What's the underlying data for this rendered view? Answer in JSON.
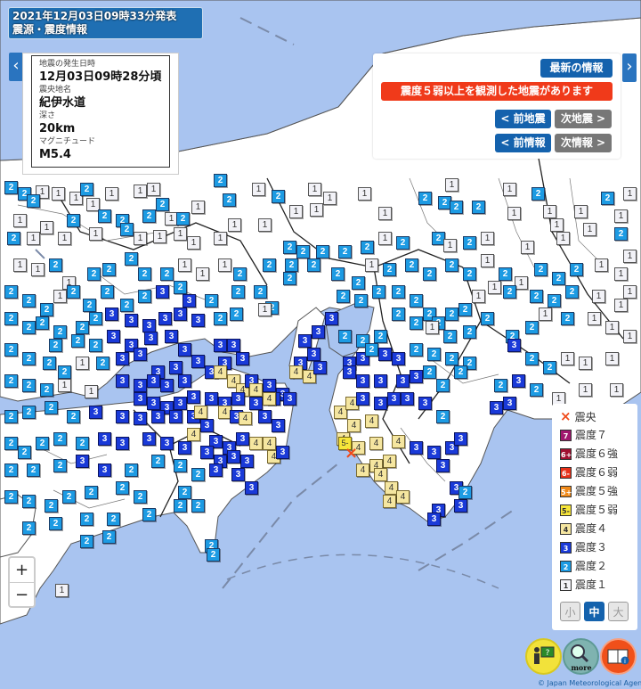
{
  "header": {
    "issued": "2021年12月03日09時33分発表",
    "title": "震源・震度情報"
  },
  "info": {
    "time_label": "地震の発生日時",
    "time_value": "12月03日09時28分頃",
    "place_label": "震央地名",
    "place_value": "紀伊水道",
    "depth_label": "深さ",
    "depth_value": "20km",
    "mag_label": "マグニチュード",
    "mag_value": "M5.4"
  },
  "controls": {
    "latest": "最新の情報",
    "alert": "震度５弱以上を観測した地震があります",
    "prev_quake": "< 前地震",
    "next_quake": "次地震 >",
    "prev_info": "< 前情報",
    "next_info": "次情報 >",
    "left_arrow": "‹",
    "right_arrow": "›"
  },
  "legend": {
    "items": [
      {
        "label": "震央",
        "badge": "×",
        "key": "epicenter"
      },
      {
        "label": "震度７",
        "badge": "7",
        "key": "7",
        "color": "#a0186e"
      },
      {
        "label": "震度６強",
        "badge": "6+",
        "key": "6plus",
        "color": "#a01030"
      },
      {
        "label": "震度６弱",
        "badge": "6-",
        "key": "6minus",
        "color": "#e8321a"
      },
      {
        "label": "震度５強",
        "badge": "5+",
        "key": "5plus",
        "color": "#f08a1a"
      },
      {
        "label": "震度５弱",
        "badge": "5-",
        "key": "5minus",
        "color": "#f7e63a"
      },
      {
        "label": "震度４",
        "badge": "4",
        "key": "4",
        "color": "#f5e6a0"
      },
      {
        "label": "震度３",
        "badge": "3",
        "key": "3",
        "color": "#1a3ad8"
      },
      {
        "label": "震度２",
        "badge": "2",
        "key": "2",
        "color": "#1d9be3"
      },
      {
        "label": "震度１",
        "badge": "1",
        "key": "1",
        "color": "#f2f2f7"
      }
    ],
    "sizes": [
      "小",
      "中",
      "大"
    ],
    "active_size": "中"
  },
  "zoom": {
    "in": "+",
    "out": "−"
  },
  "tools": [
    {
      "name": "help",
      "label": "?"
    },
    {
      "name": "more",
      "label": "more"
    },
    {
      "name": "info",
      "label": "i"
    }
  ],
  "attribution": "© Japan Meteorological Agency",
  "epicenter_mark": "×",
  "markers": [
    [
      "1",
      40,
      208
    ],
    [
      "2",
      5,
      203
    ],
    [
      "2",
      20,
      210
    ],
    [
      "2",
      30,
      218
    ],
    [
      "1",
      58,
      210
    ],
    [
      "1",
      78,
      215
    ],
    [
      "2",
      90,
      205
    ],
    [
      "1",
      97,
      222
    ],
    [
      "1",
      118,
      210
    ],
    [
      "2",
      130,
      240
    ],
    [
      "1",
      150,
      207
    ],
    [
      "1",
      165,
      205
    ],
    [
      "1",
      185,
      238
    ],
    [
      "2",
      160,
      235
    ],
    [
      "2",
      175,
      222
    ],
    [
      "1",
      215,
      225
    ],
    [
      "2",
      240,
      195
    ],
    [
      "2",
      250,
      217
    ],
    [
      "1",
      283,
      205
    ],
    [
      "2",
      305,
      213
    ],
    [
      "1",
      325,
      230
    ],
    [
      "1",
      346,
      205
    ],
    [
      "1",
      348,
      228
    ],
    [
      "1",
      363,
      215
    ],
    [
      "1",
      402,
      210
    ],
    [
      "1",
      425,
      232
    ],
    [
      "2",
      470,
      215
    ],
    [
      "2",
      492,
      220
    ],
    [
      "2",
      505,
      225
    ],
    [
      "2",
      530,
      225
    ],
    [
      "1",
      570,
      232
    ],
    [
      "1",
      500,
      200
    ],
    [
      "1",
      565,
      205
    ],
    [
      "2",
      597,
      210
    ],
    [
      "1",
      610,
      230
    ],
    [
      "1",
      618,
      245
    ],
    [
      "1",
      645,
      230
    ],
    [
      "2",
      675,
      215
    ],
    [
      "1",
      700,
      210
    ],
    [
      "1",
      690,
      235
    ],
    [
      "1",
      15,
      240
    ],
    [
      "1",
      30,
      260
    ],
    [
      "1",
      45,
      248
    ],
    [
      "2",
      8,
      260
    ],
    [
      "1",
      65,
      260
    ],
    [
      "2",
      75,
      240
    ],
    [
      "1",
      100,
      255
    ],
    [
      "2",
      110,
      235
    ],
    [
      "2",
      135,
      250
    ],
    [
      "1",
      150,
      260
    ],
    [
      "1",
      172,
      258
    ],
    [
      "1",
      195,
      255
    ],
    [
      "1",
      210,
      265
    ],
    [
      "2",
      198,
      238
    ],
    [
      "1",
      240,
      260
    ],
    [
      "1",
      256,
      245
    ],
    [
      "1",
      290,
      245
    ],
    [
      "2",
      318,
      270
    ],
    [
      "2",
      333,
      275
    ],
    [
      "2",
      355,
      275
    ],
    [
      "2",
      380,
      275
    ],
    [
      "2",
      405,
      270
    ],
    [
      "1",
      425,
      260
    ],
    [
      "2",
      445,
      265
    ],
    [
      "2",
      485,
      260
    ],
    [
      "1",
      498,
      268
    ],
    [
      "2",
      520,
      265
    ],
    [
      "1",
      540,
      260
    ],
    [
      "1",
      585,
      270
    ],
    [
      "1",
      625,
      260
    ],
    [
      "1",
      655,
      250
    ],
    [
      "2",
      690,
      255
    ],
    [
      "1",
      700,
      280
    ],
    [
      "1",
      15,
      290
    ],
    [
      "1",
      35,
      295
    ],
    [
      "2",
      55,
      290
    ],
    [
      "1",
      70,
      310
    ],
    [
      "2",
      98,
      300
    ],
    [
      "2",
      115,
      295
    ],
    [
      "2",
      140,
      283
    ],
    [
      "2",
      155,
      300
    ],
    [
      "2",
      180,
      300
    ],
    [
      "1",
      200,
      290
    ],
    [
      "1",
      220,
      300
    ],
    [
      "1",
      245,
      290
    ],
    [
      "2",
      262,
      300
    ],
    [
      "2",
      295,
      290
    ],
    [
      "2",
      320,
      290
    ],
    [
      "2",
      345,
      290
    ],
    [
      "2",
      372,
      300
    ],
    [
      "2",
      395,
      310
    ],
    [
      "1",
      410,
      290
    ],
    [
      "2",
      430,
      295
    ],
    [
      "2",
      455,
      290
    ],
    [
      "2",
      475,
      300
    ],
    [
      "2",
      500,
      290
    ],
    [
      "2",
      520,
      300
    ],
    [
      "1",
      540,
      285
    ],
    [
      "2",
      560,
      300
    ],
    [
      "1",
      578,
      310
    ],
    [
      "2",
      600,
      295
    ],
    [
      "2",
      620,
      305
    ],
    [
      "2",
      640,
      295
    ],
    [
      "1",
      668,
      290
    ],
    [
      "1",
      690,
      300
    ],
    [
      "1",
      700,
      320
    ],
    [
      "2",
      5,
      320
    ],
    [
      "2",
      25,
      330
    ],
    [
      "2",
      45,
      340
    ],
    [
      "1",
      60,
      325
    ],
    [
      "2",
      75,
      320
    ],
    [
      "2",
      93,
      335
    ],
    [
      "2",
      113,
      320
    ],
    [
      "2",
      135,
      335
    ],
    [
      "2",
      155,
      325
    ],
    [
      "3",
      175,
      320
    ],
    [
      "2",
      195,
      315
    ],
    [
      "3",
      205,
      330
    ],
    [
      "2",
      230,
      330
    ],
    [
      "2",
      260,
      320
    ],
    [
      "2",
      285,
      320
    ],
    [
      "2",
      298,
      338
    ],
    [
      "2",
      318,
      305
    ],
    [
      "1",
      290,
      340
    ],
    [
      "3",
      365,
      350
    ],
    [
      "3",
      350,
      365
    ],
    [
      "2",
      378,
      325
    ],
    [
      "2",
      398,
      330
    ],
    [
      "2",
      418,
      320
    ],
    [
      "2",
      440,
      320
    ],
    [
      "2",
      460,
      330
    ],
    [
      "2",
      475,
      345
    ],
    [
      "2",
      485,
      355
    ],
    [
      "2",
      500,
      345
    ],
    [
      "2",
      515,
      340
    ],
    [
      "1",
      530,
      325
    ],
    [
      "1",
      548,
      315
    ],
    [
      "2",
      565,
      320
    ],
    [
      "2",
      595,
      325
    ],
    [
      "2",
      615,
      330
    ],
    [
      "2",
      635,
      320
    ],
    [
      "1",
      665,
      325
    ],
    [
      "1",
      690,
      335
    ],
    [
      "2",
      5,
      350
    ],
    [
      "2",
      25,
      360
    ],
    [
      "2",
      40,
      355
    ],
    [
      "2",
      60,
      365
    ],
    [
      "2",
      85,
      360
    ],
    [
      "2",
      100,
      350
    ],
    [
      "3",
      118,
      345
    ],
    [
      "3",
      140,
      352
    ],
    [
      "3",
      160,
      358
    ],
    [
      "3",
      178,
      350
    ],
    [
      "3",
      195,
      345
    ],
    [
      "3",
      215,
      352
    ],
    [
      "2",
      240,
      350
    ],
    [
      "2",
      258,
      345
    ],
    [
      "3",
      120,
      370
    ],
    [
      "3",
      140,
      380
    ],
    [
      "3",
      162,
      372
    ],
    [
      "3",
      185,
      370
    ],
    [
      "3",
      200,
      385
    ],
    [
      "3",
      240,
      380
    ],
    [
      "3",
      255,
      380
    ],
    [
      "2",
      100,
      380
    ],
    [
      "2",
      80,
      375
    ],
    [
      "2",
      55,
      380
    ],
    [
      "3",
      335,
      375
    ],
    [
      "3",
      345,
      390
    ],
    [
      "3",
      330,
      400
    ],
    [
      "2",
      380,
      370
    ],
    [
      "2",
      400,
      375
    ],
    [
      "2",
      420,
      370
    ],
    [
      "2",
      440,
      345
    ],
    [
      "2",
      460,
      355
    ],
    [
      "1",
      478,
      360
    ],
    [
      "2",
      498,
      370
    ],
    [
      "2",
      520,
      365
    ],
    [
      "2",
      540,
      350
    ],
    [
      "2",
      568,
      370
    ],
    [
      "2",
      590,
      360
    ],
    [
      "1",
      605,
      345
    ],
    [
      "2",
      630,
      350
    ],
    [
      "1",
      660,
      350
    ],
    [
      "1",
      680,
      360
    ],
    [
      "1",
      700,
      370
    ],
    [
      "2",
      5,
      385
    ],
    [
      "2",
      25,
      395
    ],
    [
      "2",
      48,
      400
    ],
    [
      "2",
      65,
      410
    ],
    [
      "1",
      85,
      400
    ],
    [
      "2",
      108,
      400
    ],
    [
      "3",
      130,
      395
    ],
    [
      "3",
      150,
      390
    ],
    [
      "3",
      170,
      410
    ],
    [
      "3",
      190,
      405
    ],
    [
      "3",
      215,
      398
    ],
    [
      "3",
      230,
      410
    ],
    [
      "3",
      245,
      400
    ],
    [
      "3",
      265,
      395
    ],
    [
      "4",
      240,
      410
    ],
    [
      "4",
      255,
      420
    ],
    [
      "4",
      265,
      430
    ],
    [
      "3",
      275,
      420
    ],
    [
      "3",
      295,
      425
    ],
    [
      "3",
      310,
      435
    ],
    [
      "4",
      325,
      410
    ],
    [
      "4",
      340,
      415
    ],
    [
      "3",
      352,
      405
    ],
    [
      "3",
      385,
      400
    ],
    [
      "3",
      400,
      395
    ],
    [
      "2",
      410,
      385
    ],
    [
      "3",
      425,
      390
    ],
    [
      "3",
      440,
      395
    ],
    [
      "2",
      460,
      385
    ],
    [
      "2",
      480,
      390
    ],
    [
      "2",
      500,
      395
    ],
    [
      "2",
      520,
      400
    ],
    [
      "3",
      570,
      380
    ],
    [
      "2",
      590,
      395
    ],
    [
      "2",
      610,
      405
    ],
    [
      "1",
      630,
      395
    ],
    [
      "1",
      650,
      400
    ],
    [
      "1",
      680,
      395
    ],
    [
      "2",
      5,
      420
    ],
    [
      "2",
      25,
      425
    ],
    [
      "2",
      45,
      430
    ],
    [
      "1",
      65,
      425
    ],
    [
      "1",
      95,
      432
    ],
    [
      "3",
      130,
      420
    ],
    [
      "3",
      150,
      425
    ],
    [
      "3",
      165,
      420
    ],
    [
      "3",
      180,
      425
    ],
    [
      "3",
      200,
      420
    ],
    [
      "3",
      210,
      438
    ],
    [
      "3",
      150,
      440
    ],
    [
      "3",
      165,
      445
    ],
    [
      "3",
      180,
      450
    ],
    [
      "3",
      195,
      445
    ],
    [
      "3",
      230,
      440
    ],
    [
      "3",
      245,
      445
    ],
    [
      "3",
      260,
      440
    ],
    [
      "3",
      280,
      445
    ],
    [
      "3",
      300,
      440
    ],
    [
      "3",
      318,
      440
    ],
    [
      "4",
      280,
      430
    ],
    [
      "4",
      295,
      440
    ],
    [
      "3",
      385,
      410
    ],
    [
      "3",
      400,
      420
    ],
    [
      "3",
      420,
      420
    ],
    [
      "3",
      445,
      420
    ],
    [
      "3",
      460,
      415
    ],
    [
      "2",
      475,
      410
    ],
    [
      "2",
      490,
      425
    ],
    [
      "2",
      510,
      410
    ],
    [
      "3",
      575,
      420
    ],
    [
      "2",
      555,
      425
    ],
    [
      "2",
      595,
      430
    ],
    [
      "1",
      620,
      440
    ],
    [
      "1",
      650,
      430
    ],
    [
      "1",
      685,
      430
    ],
    [
      "2",
      5,
      460
    ],
    [
      "2",
      25,
      455
    ],
    [
      "2",
      50,
      450
    ],
    [
      "2",
      75,
      460
    ],
    [
      "3",
      100,
      455
    ],
    [
      "3",
      130,
      460
    ],
    [
      "3",
      150,
      462
    ],
    [
      "3",
      170,
      460
    ],
    [
      "3",
      190,
      460
    ],
    [
      "3",
      210,
      460
    ],
    [
      "3",
      225,
      470
    ],
    [
      "4",
      218,
      455
    ],
    [
      "4",
      245,
      455
    ],
    [
      "3",
      258,
      460
    ],
    [
      "4",
      268,
      462
    ],
    [
      "3",
      290,
      460
    ],
    [
      "3",
      305,
      470
    ],
    [
      "4",
      375,
      455
    ],
    [
      "4",
      388,
      445
    ],
    [
      "3",
      400,
      440
    ],
    [
      "3",
      420,
      445
    ],
    [
      "3",
      435,
      440
    ],
    [
      "4",
      410,
      465
    ],
    [
      "4",
      390,
      470
    ],
    [
      "3",
      450,
      440
    ],
    [
      "3",
      470,
      445
    ],
    [
      "2",
      490,
      460
    ],
    [
      "3",
      550,
      450
    ],
    [
      "3",
      565,
      445
    ],
    [
      "1",
      620,
      470
    ],
    [
      "2",
      5,
      490
    ],
    [
      "2",
      20,
      500
    ],
    [
      "2",
      40,
      490
    ],
    [
      "2",
      60,
      485
    ],
    [
      "2",
      85,
      490
    ],
    [
      "3",
      110,
      485
    ],
    [
      "3",
      130,
      490
    ],
    [
      "3",
      160,
      485
    ],
    [
      "3",
      180,
      490
    ],
    [
      "3",
      200,
      495
    ],
    [
      "4",
      210,
      480
    ],
    [
      "3",
      235,
      488
    ],
    [
      "3",
      250,
      495
    ],
    [
      "3",
      265,
      485
    ],
    [
      "4",
      280,
      490
    ],
    [
      "4",
      295,
      490
    ],
    [
      "4",
      300,
      505
    ],
    [
      "3",
      270,
      510
    ],
    [
      "3",
      255,
      505
    ],
    [
      "3",
      240,
      510
    ],
    [
      "3",
      225,
      500
    ],
    [
      "3",
      310,
      500
    ],
    [
      "4",
      378,
      485
    ],
    [
      "5-",
      380,
      490
    ],
    [
      "4",
      395,
      495
    ],
    [
      "4",
      415,
      490
    ],
    [
      "4",
      440,
      488
    ],
    [
      "3",
      460,
      495
    ],
    [
      "3",
      480,
      500
    ],
    [
      "3",
      500,
      495
    ],
    [
      "3",
      510,
      485
    ],
    [
      "4",
      430,
      510
    ],
    [
      "4",
      415,
      515
    ],
    [
      "4",
      400,
      520
    ],
    [
      "3",
      490,
      515
    ],
    [
      "2",
      5,
      520
    ],
    [
      "2",
      30,
      520
    ],
    [
      "2",
      60,
      515
    ],
    [
      "3",
      85,
      510
    ],
    [
      "3",
      110,
      520
    ],
    [
      "2",
      140,
      520
    ],
    [
      "2",
      170,
      510
    ],
    [
      "2",
      195,
      515
    ],
    [
      "2",
      215,
      525
    ],
    [
      "3",
      235,
      520
    ],
    [
      "3",
      260,
      525
    ],
    [
      "3",
      275,
      540
    ],
    [
      "2",
      200,
      545
    ],
    [
      "2",
      195,
      560
    ],
    [
      "2",
      215,
      560
    ],
    [
      "4",
      420,
      525
    ],
    [
      "4",
      432,
      540
    ],
    [
      "4",
      445,
      550
    ],
    [
      "4",
      430,
      555
    ],
    [
      "3",
      505,
      540
    ],
    [
      "3",
      510,
      560
    ],
    [
      "2",
      515,
      545
    ],
    [
      "3",
      485,
      565
    ],
    [
      "3",
      480,
      575
    ],
    [
      "2",
      5,
      550
    ],
    [
      "2",
      25,
      555
    ],
    [
      "2",
      50,
      560
    ],
    [
      "2",
      70,
      550
    ],
    [
      "2",
      95,
      545
    ],
    [
      "2",
      130,
      540
    ],
    [
      "2",
      150,
      550
    ],
    [
      "2",
      160,
      570
    ],
    [
      "2",
      120,
      575
    ],
    [
      "2",
      90,
      575
    ],
    [
      "2",
      55,
      580
    ],
    [
      "2",
      25,
      585
    ],
    [
      "2",
      115,
      595
    ],
    [
      "2",
      90,
      600
    ],
    [
      "2",
      230,
      605
    ],
    [
      "2",
      232,
      615
    ],
    [
      "1",
      62,
      655
    ]
  ]
}
